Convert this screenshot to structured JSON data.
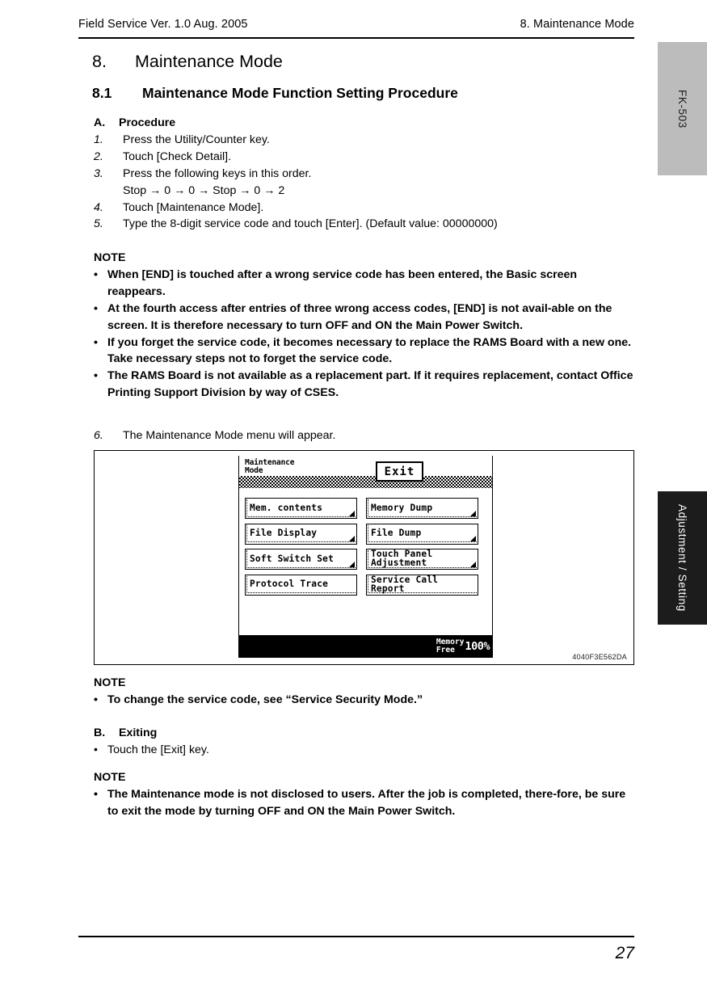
{
  "header": {
    "left": "Field Service Ver. 1.0 Aug. 2005",
    "right": "8. Maintenance Mode"
  },
  "tabs": {
    "model": "FK-503",
    "section": "Adjustment / Setting"
  },
  "chapter": {
    "number": "8.",
    "title": "Maintenance Mode"
  },
  "section": {
    "number": "8.1",
    "title": "Maintenance Mode Function Setting Procedure"
  },
  "procedure": {
    "letter": "A.",
    "heading": "Procedure",
    "steps": [
      {
        "n": "1.",
        "text": "Press the Utility/Counter key."
      },
      {
        "n": "2.",
        "text": "Touch [Check Detail]."
      },
      {
        "n": "3.",
        "text": "Press the following keys in this order."
      },
      {
        "n": "4.",
        "text": "Touch [Maintenance Mode]."
      },
      {
        "n": "5.",
        "text": "Type the 8-digit service code and touch [Enter]. (Default value: 00000000)"
      },
      {
        "n": "6.",
        "text": "The Maintenance Mode menu will appear."
      }
    ],
    "key_sequence": "Stop → 0 → 0 → Stop → 0 → 2"
  },
  "note1": {
    "title": "NOTE",
    "bullet_char": "•",
    "items": [
      "When [END] is touched after a wrong service code has been entered, the Basic screen reappears.",
      "At the fourth access after entries of three wrong access codes, [END] is not avail-able on the screen. It is therefore necessary to turn OFF and ON the Main Power Switch.",
      "If you forget the service code, it becomes necessary to replace the RAMS Board with a new one. Take necessary steps not to forget the service code.",
      "The RAMS Board is not available as a replacement part. If it requires replacement, contact Office Printing Support Division by way of CSES."
    ]
  },
  "figure": {
    "caption_id": "4040F3E562DA",
    "lcd": {
      "title": "Maintenance\nMode",
      "exit_label": "Exit",
      "buttons": [
        {
          "label": "Mem. contents",
          "submenu": true
        },
        {
          "label": "Memory Dump",
          "submenu": true
        },
        {
          "label": "File Display",
          "submenu": true
        },
        {
          "label": "File Dump",
          "submenu": true
        },
        {
          "label": "Soft Switch Set",
          "submenu": true
        },
        {
          "label": "Touch Panel\nAdjustment",
          "submenu": true
        },
        {
          "label": "Protocol Trace",
          "submenu": false
        },
        {
          "label": "Service Call\nReport",
          "submenu": false
        }
      ],
      "status": {
        "memory_label": "Memory\nFree",
        "memory_value": "100%"
      }
    }
  },
  "note2": {
    "title": "NOTE",
    "bullet_char": "•",
    "items": [
      "To change the service code, see “Service Security Mode.”"
    ]
  },
  "exiting": {
    "letter": "B.",
    "heading": "Exiting",
    "bullet_char": "•",
    "items": [
      "Touch the [Exit] key."
    ]
  },
  "note3": {
    "title": "NOTE",
    "bullet_char": "•",
    "items": [
      "The Maintenance mode is not disclosed to users. After the job is completed, there-fore, be sure to exit the mode by turning OFF and ON the Main Power Switch."
    ]
  },
  "footer": {
    "page_number": "27"
  }
}
